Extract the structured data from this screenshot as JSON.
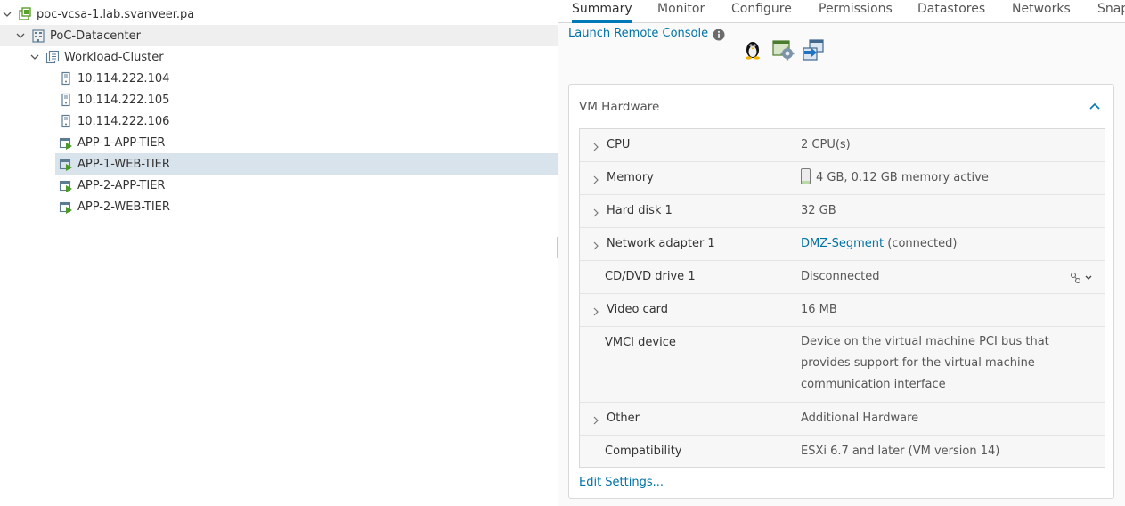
{
  "tree": {
    "items": [
      {
        "label": "poc-vcsa-1.lab.svanveer.pa",
        "icon": "vcenter-icon",
        "expanded": true
      },
      {
        "label": "PoC-Datacenter",
        "icon": "datacenter-icon",
        "expanded": true
      },
      {
        "label": "Workload-Cluster",
        "icon": "cluster-icon",
        "expanded": true
      },
      {
        "label": "10.114.222.104",
        "icon": "host-icon"
      },
      {
        "label": "10.114.222.105",
        "icon": "host-icon"
      },
      {
        "label": "10.114.222.106",
        "icon": "host-icon"
      },
      {
        "label": "APP-1-APP-TIER",
        "icon": "vm-powered-on-icon"
      },
      {
        "label": "APP-1-WEB-TIER",
        "icon": "vm-powered-on-icon",
        "selected": true
      },
      {
        "label": "APP-2-APP-TIER",
        "icon": "vm-powered-on-icon"
      },
      {
        "label": "APP-2-WEB-TIER",
        "icon": "vm-powered-on-icon"
      }
    ]
  },
  "tabs": [
    {
      "label": "Summary",
      "active": true
    },
    {
      "label": "Monitor"
    },
    {
      "label": "Configure"
    },
    {
      "label": "Permissions"
    },
    {
      "label": "Datastores"
    },
    {
      "label": "Networks"
    },
    {
      "label": "Snap"
    }
  ],
  "summary": {
    "launch_console": "Launch Remote Console",
    "guest_os_icon": "linux-tux-icon",
    "vmware_tools_icon": "vmware-tools-icon",
    "migrate_icon": "migrate-icon"
  },
  "hardware": {
    "title": "VM Hardware",
    "rows": [
      {
        "label": "CPU",
        "value": "2 CPU(s)",
        "expandable": true
      },
      {
        "label": "Memory",
        "value": "4 GB, 0.12 GB memory active",
        "expandable": true,
        "memory_active_fraction": 0.03
      },
      {
        "label": "Hard disk 1",
        "value": "32 GB",
        "expandable": true
      },
      {
        "label": "Network adapter 1",
        "link": "DMZ-Segment",
        "value_suffix": "(connected)",
        "expandable": true
      },
      {
        "label": "CD/DVD drive 1",
        "value": "Disconnected",
        "expandable": false
      },
      {
        "label": "Video card",
        "value": "16 MB",
        "expandable": true
      },
      {
        "label": "VMCI device",
        "value": "Device on the virtual machine PCI bus that provides support for the virtual machine communication interface",
        "expandable": false
      },
      {
        "label": "Other",
        "value": "Additional Hardware",
        "expandable": true
      },
      {
        "label": "Compatibility",
        "value": "ESXi 6.7 and later (VM version 14)",
        "expandable": false
      }
    ],
    "edit_settings": "Edit Settings..."
  },
  "colors": {
    "link": "#0072a3",
    "tab_active_underline": "#0079b8",
    "selected_row": "#d8e3ec",
    "vm_green": "#4a9a28"
  }
}
